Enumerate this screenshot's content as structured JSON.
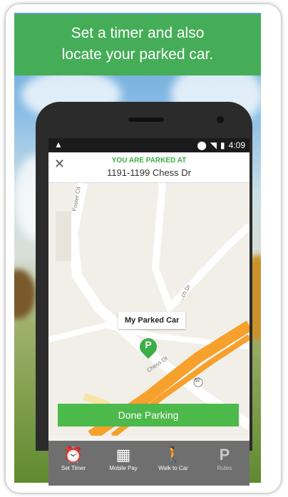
{
  "banner": {
    "line1": "Set a timer and also",
    "line2": "locate your parked car."
  },
  "status": {
    "nav_icon": "navigation-arrow-icon",
    "icons": [
      "location-icon",
      "wifi-icon",
      "battery-icon"
    ],
    "time": "4:09"
  },
  "header": {
    "close_icon": "close-icon",
    "label": "YOU ARE PARKED AT",
    "address": "1191-1199 Chess Dr"
  },
  "map": {
    "marker_label": "My Parked Car",
    "pin_letter": "P",
    "street_labels": [
      "Foster Cit",
      "Chess Dr",
      "...ch Dr",
      "92"
    ]
  },
  "done_button": "Done Parking",
  "bottom_nav": [
    {
      "icon": "alarm-clock-icon",
      "label": "Set Timer"
    },
    {
      "icon": "mobile-pay-icon",
      "label": "Mobile Pay"
    },
    {
      "icon": "walking-person-icon",
      "label": "Walk to Car"
    },
    {
      "icon": "parking-sign-icon",
      "label": "Rules"
    }
  ],
  "colors": {
    "green": "#45ad57",
    "bar": "#6f6f6f"
  }
}
